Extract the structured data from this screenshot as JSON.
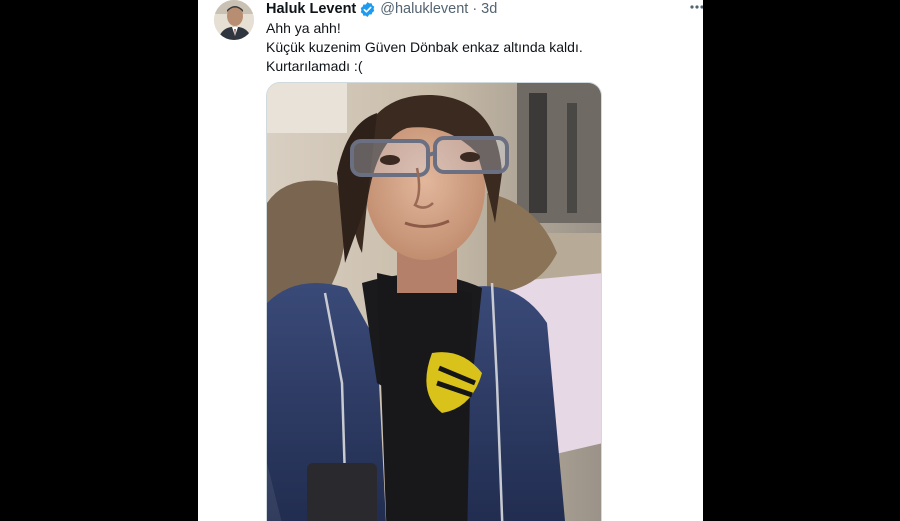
{
  "colors": {
    "background": "#000000",
    "card": "#ffffff",
    "name": "#0f1419",
    "secondary": "#536471",
    "verified": "#1d9bf0"
  },
  "tweet": {
    "author": {
      "display_name": "Haluk Levent",
      "handle": "@haluklevent",
      "verified_icon": "verified-badge-icon"
    },
    "separator": "·",
    "time": "3d",
    "more_icon": "more-options-icon",
    "text_lines": [
      "Ahh ya ahh!",
      "Küçük kuzenim Güven Dönbak enkaz altında kaldı.",
      "Kurtarılamadı :("
    ],
    "media": {
      "type": "photo"
    }
  }
}
